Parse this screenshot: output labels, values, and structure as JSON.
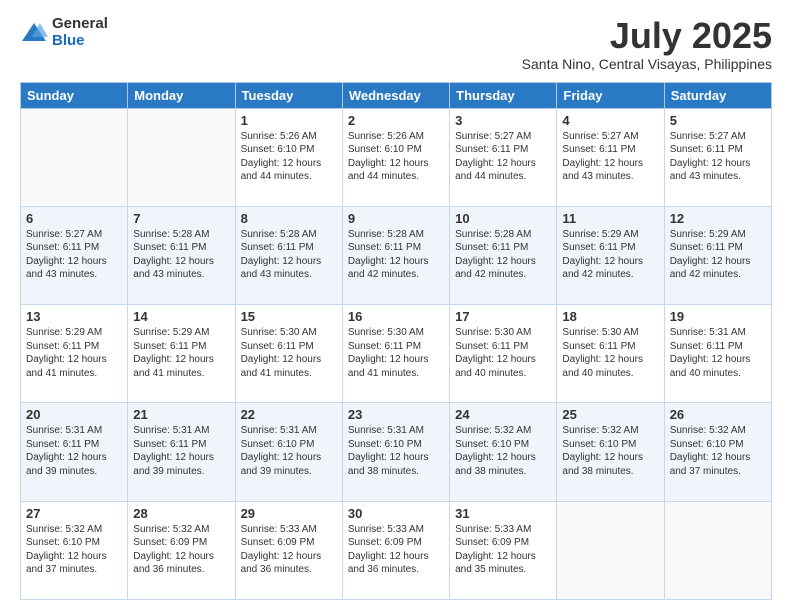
{
  "logo": {
    "general": "General",
    "blue": "Blue"
  },
  "title": "July 2025",
  "subtitle": "Santa Nino, Central Visayas, Philippines",
  "days_of_week": [
    "Sunday",
    "Monday",
    "Tuesday",
    "Wednesday",
    "Thursday",
    "Friday",
    "Saturday"
  ],
  "weeks": [
    [
      {
        "day": "",
        "info": ""
      },
      {
        "day": "",
        "info": ""
      },
      {
        "day": "1",
        "info": "Sunrise: 5:26 AM\nSunset: 6:10 PM\nDaylight: 12 hours and 44 minutes."
      },
      {
        "day": "2",
        "info": "Sunrise: 5:26 AM\nSunset: 6:10 PM\nDaylight: 12 hours and 44 minutes."
      },
      {
        "day": "3",
        "info": "Sunrise: 5:27 AM\nSunset: 6:11 PM\nDaylight: 12 hours and 44 minutes."
      },
      {
        "day": "4",
        "info": "Sunrise: 5:27 AM\nSunset: 6:11 PM\nDaylight: 12 hours and 43 minutes."
      },
      {
        "day": "5",
        "info": "Sunrise: 5:27 AM\nSunset: 6:11 PM\nDaylight: 12 hours and 43 minutes."
      }
    ],
    [
      {
        "day": "6",
        "info": "Sunrise: 5:27 AM\nSunset: 6:11 PM\nDaylight: 12 hours and 43 minutes."
      },
      {
        "day": "7",
        "info": "Sunrise: 5:28 AM\nSunset: 6:11 PM\nDaylight: 12 hours and 43 minutes."
      },
      {
        "day": "8",
        "info": "Sunrise: 5:28 AM\nSunset: 6:11 PM\nDaylight: 12 hours and 43 minutes."
      },
      {
        "day": "9",
        "info": "Sunrise: 5:28 AM\nSunset: 6:11 PM\nDaylight: 12 hours and 42 minutes."
      },
      {
        "day": "10",
        "info": "Sunrise: 5:28 AM\nSunset: 6:11 PM\nDaylight: 12 hours and 42 minutes."
      },
      {
        "day": "11",
        "info": "Sunrise: 5:29 AM\nSunset: 6:11 PM\nDaylight: 12 hours and 42 minutes."
      },
      {
        "day": "12",
        "info": "Sunrise: 5:29 AM\nSunset: 6:11 PM\nDaylight: 12 hours and 42 minutes."
      }
    ],
    [
      {
        "day": "13",
        "info": "Sunrise: 5:29 AM\nSunset: 6:11 PM\nDaylight: 12 hours and 41 minutes."
      },
      {
        "day": "14",
        "info": "Sunrise: 5:29 AM\nSunset: 6:11 PM\nDaylight: 12 hours and 41 minutes."
      },
      {
        "day": "15",
        "info": "Sunrise: 5:30 AM\nSunset: 6:11 PM\nDaylight: 12 hours and 41 minutes."
      },
      {
        "day": "16",
        "info": "Sunrise: 5:30 AM\nSunset: 6:11 PM\nDaylight: 12 hours and 41 minutes."
      },
      {
        "day": "17",
        "info": "Sunrise: 5:30 AM\nSunset: 6:11 PM\nDaylight: 12 hours and 40 minutes."
      },
      {
        "day": "18",
        "info": "Sunrise: 5:30 AM\nSunset: 6:11 PM\nDaylight: 12 hours and 40 minutes."
      },
      {
        "day": "19",
        "info": "Sunrise: 5:31 AM\nSunset: 6:11 PM\nDaylight: 12 hours and 40 minutes."
      }
    ],
    [
      {
        "day": "20",
        "info": "Sunrise: 5:31 AM\nSunset: 6:11 PM\nDaylight: 12 hours and 39 minutes."
      },
      {
        "day": "21",
        "info": "Sunrise: 5:31 AM\nSunset: 6:11 PM\nDaylight: 12 hours and 39 minutes."
      },
      {
        "day": "22",
        "info": "Sunrise: 5:31 AM\nSunset: 6:10 PM\nDaylight: 12 hours and 39 minutes."
      },
      {
        "day": "23",
        "info": "Sunrise: 5:31 AM\nSunset: 6:10 PM\nDaylight: 12 hours and 38 minutes."
      },
      {
        "day": "24",
        "info": "Sunrise: 5:32 AM\nSunset: 6:10 PM\nDaylight: 12 hours and 38 minutes."
      },
      {
        "day": "25",
        "info": "Sunrise: 5:32 AM\nSunset: 6:10 PM\nDaylight: 12 hours and 38 minutes."
      },
      {
        "day": "26",
        "info": "Sunrise: 5:32 AM\nSunset: 6:10 PM\nDaylight: 12 hours and 37 minutes."
      }
    ],
    [
      {
        "day": "27",
        "info": "Sunrise: 5:32 AM\nSunset: 6:10 PM\nDaylight: 12 hours and 37 minutes."
      },
      {
        "day": "28",
        "info": "Sunrise: 5:32 AM\nSunset: 6:09 PM\nDaylight: 12 hours and 36 minutes."
      },
      {
        "day": "29",
        "info": "Sunrise: 5:33 AM\nSunset: 6:09 PM\nDaylight: 12 hours and 36 minutes."
      },
      {
        "day": "30",
        "info": "Sunrise: 5:33 AM\nSunset: 6:09 PM\nDaylight: 12 hours and 36 minutes."
      },
      {
        "day": "31",
        "info": "Sunrise: 5:33 AM\nSunset: 6:09 PM\nDaylight: 12 hours and 35 minutes."
      },
      {
        "day": "",
        "info": ""
      },
      {
        "day": "",
        "info": ""
      }
    ]
  ]
}
